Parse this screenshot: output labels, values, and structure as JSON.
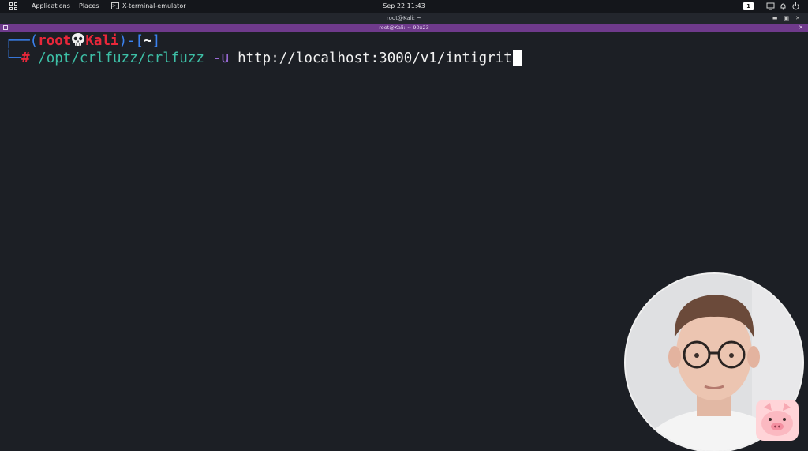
{
  "top_panel": {
    "menu": [
      {
        "label": "Applications"
      },
      {
        "label": "Places"
      },
      {
        "label": "X-terminal-emulator"
      }
    ],
    "clock": "Sep 22  11:43",
    "workspace": "1",
    "icons": {
      "apps": "grid-icon",
      "terminal": "terminal-icon",
      "tray": [
        "screen-icon",
        "bell-icon",
        "power-icon"
      ]
    }
  },
  "window": {
    "title": "root@Kali: ~",
    "tab_title": "root@Kali: ~ 90x23",
    "controls": [
      "minimize",
      "maximize",
      "close"
    ]
  },
  "terminal": {
    "prompt": {
      "open_frame": "┌──(",
      "user": "root",
      "host": "Kali",
      "close_user": ")-[",
      "dir": "~",
      "close_dir": "]",
      "corner": "└─",
      "hash": "#"
    },
    "command": {
      "program": "/opt/crlfuzz/crlfuzz",
      "flag": "-u",
      "argument": "http://localhost:3000/v1/intigrit"
    }
  },
  "colors": {
    "panel_bg": "#14161b",
    "terminal_bg": "#1c1f25",
    "tab_bar": "#6f3a8c",
    "prompt_blue": "#3b82f0",
    "prompt_red": "#e8273a",
    "command_teal": "#3dbfa6",
    "flag_purple": "#9a6ad6"
  },
  "overlay": {
    "webcam": "presenter-webcam",
    "logo": "pig-logo"
  }
}
